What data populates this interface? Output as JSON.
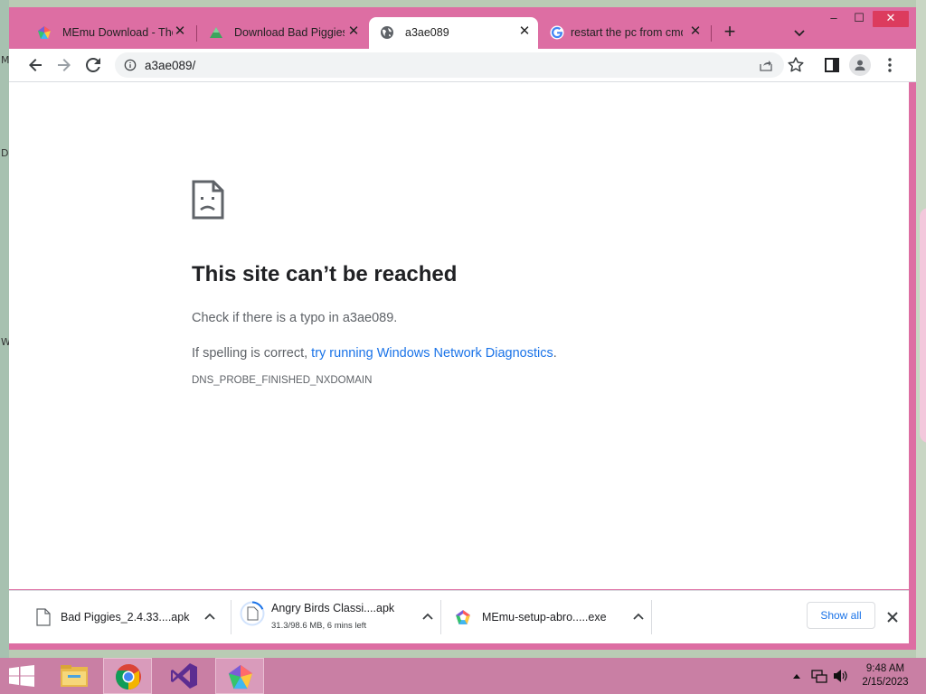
{
  "desktop": {
    "left_letters": [
      "M",
      "D",
      "W"
    ]
  },
  "window": {
    "controls": {
      "minimize": "–",
      "maximize": "☐",
      "close": "✕"
    },
    "tabs": [
      {
        "title": "MEmu Download - The",
        "favicon": "memu-icon"
      },
      {
        "title": "Download Bad Piggies",
        "favicon": "android-icon"
      },
      {
        "title": "a3ae089",
        "favicon": "globe-icon"
      },
      {
        "title": "restart the pc from cmd",
        "favicon": "google-icon"
      }
    ],
    "new_tab": "+"
  },
  "toolbar": {
    "url": "a3ae089/"
  },
  "error_page": {
    "title": "This site can’t be reached",
    "line1": "Check if there is a typo in a3ae089.",
    "line2_prefix": "If spelling is correct, ",
    "line2_link": "try running Windows Network Diagnostics",
    "line2_suffix": ".",
    "code": "DNS_PROBE_FINISHED_NXDOMAIN"
  },
  "downloads": {
    "items": [
      {
        "name": "Bad Piggies_2.4.33....apk",
        "status": ""
      },
      {
        "name": "Angry Birds Classi....apk",
        "status": "31.3/98.6 MB, 6 mins left"
      },
      {
        "name": "MEmu-setup-abro.....exe",
        "status": ""
      }
    ],
    "show_all": "Show all"
  },
  "taskbar": {
    "apps": [
      "file-explorer-icon",
      "chrome-icon",
      "visual-studio-icon",
      "memu-icon"
    ],
    "time": "9:48 AM",
    "date": "2/15/2023"
  },
  "colors": {
    "window_frame": "#dd6ea3",
    "link": "#1a73e8",
    "taskbar": "#c97fa4"
  }
}
